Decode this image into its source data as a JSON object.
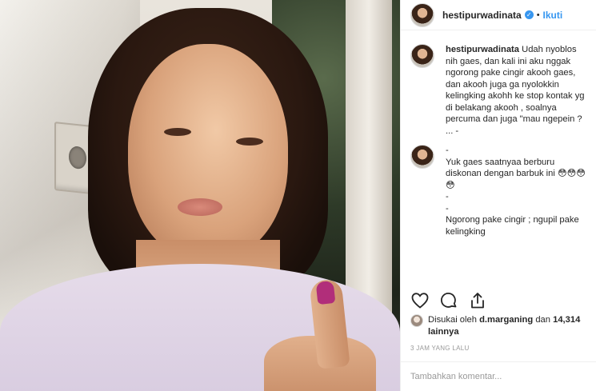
{
  "post": {
    "username": "hestipurwadinata",
    "verified_icon": "verified-badge-icon",
    "separator": "•",
    "follow_label": "Ikuti",
    "caption_user": "hestipurwadinata",
    "caption_text": "Udah nyoblos nih gaes, dan kali ini aku nggak ngorong pake cingir akooh gaes, dan akooh juga ga nyolokkin kelingking akohh ke stop kontak yg di belakang akooh , soalnya percuma dan juga \"mau ngepein ? ... -",
    "comment_text": "-\nYuk gaes saatnyaa berburu diskonan dengan barbuk ini 😳😳😳😳\n-\n-\nNgorong pake cingir ; ngupil pake kelingking",
    "liked_by_prefix": "Disukai oleh",
    "liked_by_user": "d.marganing",
    "liked_by_and": "dan",
    "likes_count": "14,314 lainnya",
    "timestamp": "3 JAM YANG LALU",
    "add_comment_placeholder": "Tambahkan komentar..."
  },
  "icons": {
    "like": "heart-icon",
    "comment": "comment-bubble-icon",
    "share": "share-icon"
  },
  "colors": {
    "link_blue": "#3897f0",
    "text": "#262626",
    "muted": "#999999",
    "nail_polish": "#b12e7a"
  }
}
